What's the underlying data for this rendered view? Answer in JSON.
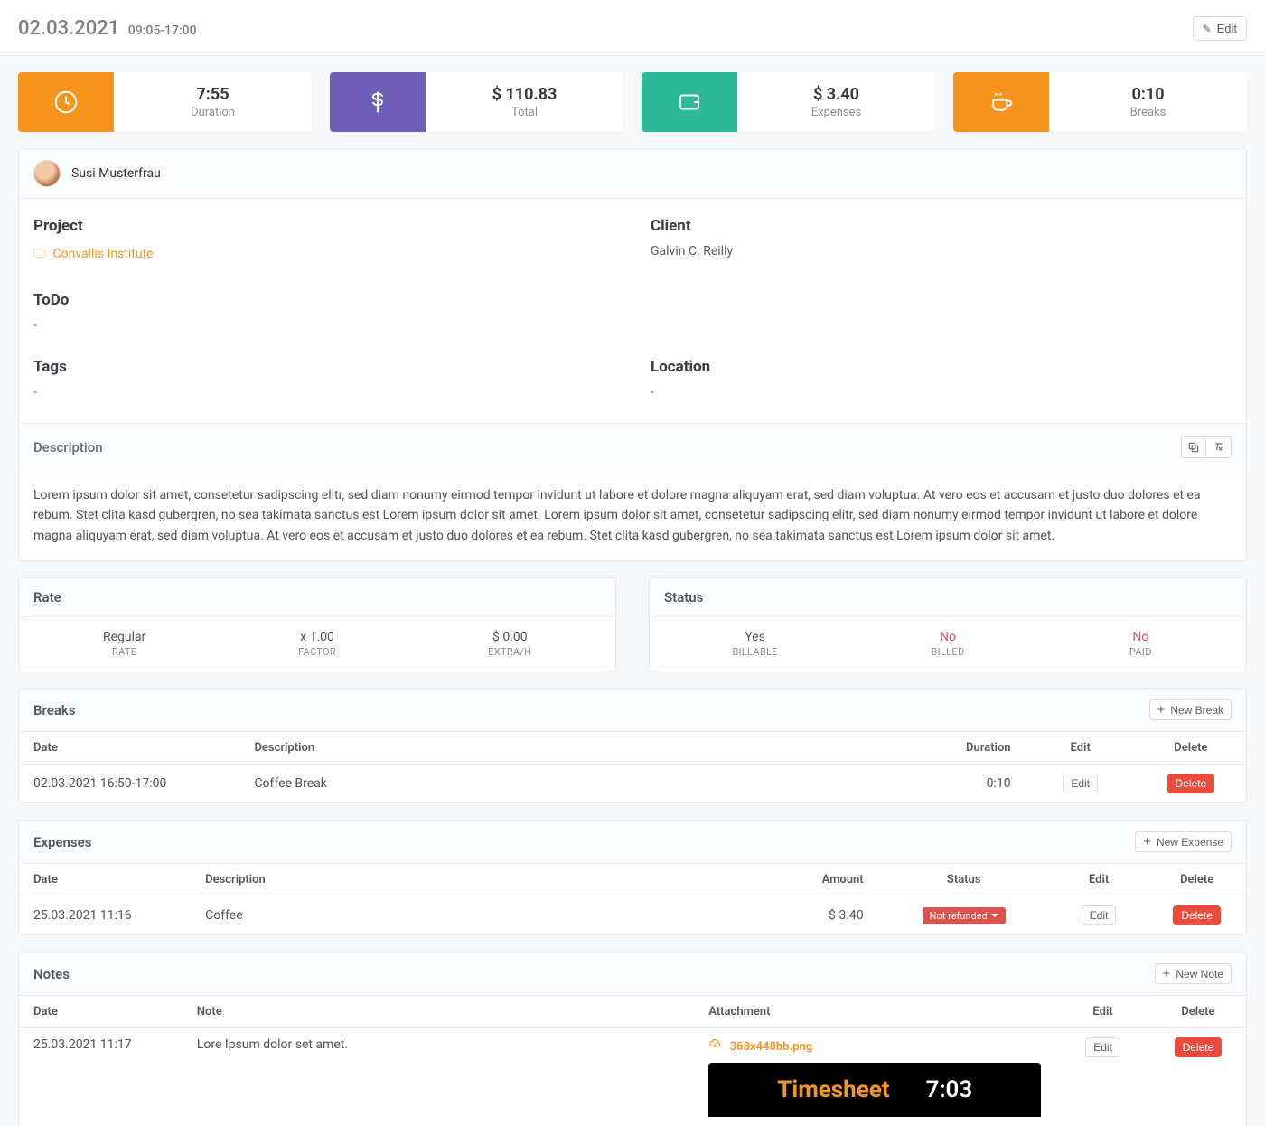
{
  "header": {
    "date": "02.03.2021",
    "time_range": "09:05-17:00",
    "edit_label": "Edit"
  },
  "stats": {
    "duration": {
      "value": "7:55",
      "label": "Duration"
    },
    "total": {
      "value": "$ 110.83",
      "label": "Total"
    },
    "expenses": {
      "value": "$ 3.40",
      "label": "Expenses"
    },
    "breaks": {
      "value": "0:10",
      "label": "Breaks"
    }
  },
  "user": {
    "name": "Susi Musterfrau"
  },
  "details": {
    "project_label": "Project",
    "project_link": "Convallis Institute",
    "client_label": "Client",
    "client_value": "Galvin C. Reilly",
    "todo_label": "ToDo",
    "todo_value": "-",
    "tags_label": "Tags",
    "tags_value": "-",
    "location_label": "Location",
    "location_value": "-"
  },
  "description": {
    "label": "Description",
    "text": "Lorem ipsum dolor sit amet, consetetur sadipscing elitr, sed diam nonumy eirmod tempor invidunt ut labore et dolore magna aliquyam erat, sed diam voluptua. At vero eos et accusam et justo duo dolores et ea rebum. Stet clita kasd gubergren, no sea takimata sanctus est Lorem ipsum dolor sit amet. Lorem ipsum dolor sit amet, consetetur sadipscing elitr, sed diam nonumy eirmod tempor invidunt ut labore et dolore magna aliquyam erat, sed diam voluptua. At vero eos et accusam et justo duo dolores et ea rebum. Stet clita kasd gubergren, no sea takimata sanctus est Lorem ipsum dolor sit amet."
  },
  "rate": {
    "label": "Rate",
    "regular_val": "Regular",
    "regular_lab": "RATE",
    "factor_val": "x 1.00",
    "factor_lab": "FACTOR",
    "extra_val": "$ 0.00",
    "extra_lab": "EXTRA/H"
  },
  "status": {
    "label": "Status",
    "billable_val": "Yes",
    "billable_lab": "BILLABLE",
    "billed_val": "No",
    "billed_lab": "BILLED",
    "paid_val": "No",
    "paid_lab": "PAID"
  },
  "breaks": {
    "label": "Breaks",
    "new_label": "New Break",
    "cols": {
      "date": "Date",
      "desc": "Description",
      "dur": "Duration",
      "edit": "Edit",
      "del": "Delete"
    },
    "rows": [
      {
        "date": "02.03.2021 16:50-17:00",
        "desc": "Coffee Break",
        "dur": "0:10",
        "edit": "Edit",
        "del": "Delete"
      }
    ]
  },
  "expenses": {
    "label": "Expenses",
    "new_label": "New Expense",
    "cols": {
      "date": "Date",
      "desc": "Description",
      "amount": "Amount",
      "status": "Status",
      "edit": "Edit",
      "del": "Delete"
    },
    "rows": [
      {
        "date": "25.03.2021 11:16",
        "desc": "Coffee",
        "amount": "$ 3.40",
        "status": "Not refunded",
        "edit": "Edit",
        "del": "Delete"
      }
    ]
  },
  "notes": {
    "label": "Notes",
    "new_label": "New Note",
    "cols": {
      "date": "Date",
      "note": "Note",
      "attach": "Attachment",
      "edit": "Edit",
      "del": "Delete"
    },
    "rows": [
      {
        "date": "25.03.2021 11:17",
        "note": "Lore Ipsum dolor set amet.",
        "attach": "368x448bb.png",
        "edit": "Edit",
        "del": "Delete"
      }
    ],
    "preview": {
      "left": "Timesheet",
      "right": "7:03"
    }
  }
}
